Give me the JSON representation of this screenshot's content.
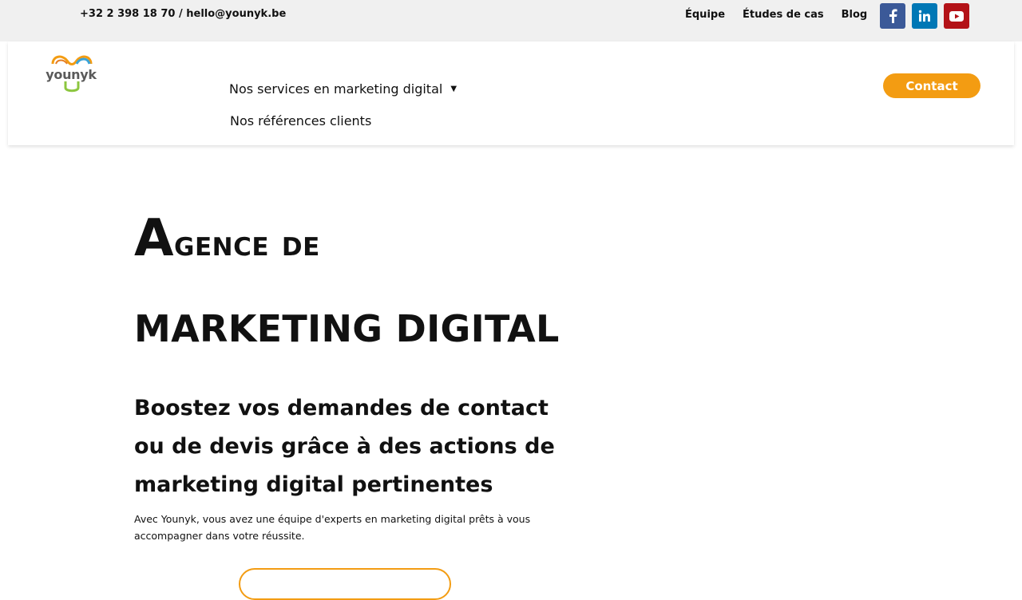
{
  "topbar": {
    "contact_line": "+32 2 398 18 70 / hello@younyk.be",
    "links": [
      "Équipe",
      "Études de cas",
      "Blog"
    ],
    "social": [
      {
        "icon": "facebook-icon",
        "color": "#3b5998"
      },
      {
        "icon": "linkedin-icon",
        "color": "#0077b5"
      },
      {
        "icon": "youtube-icon",
        "color": "#b31217"
      }
    ]
  },
  "header": {
    "logo_text": "younyk",
    "nav": {
      "services": "Nos services en marketing digital",
      "references": "Nos références clients"
    },
    "contact_button": "Contact"
  },
  "hero": {
    "title_line1_initial": "A",
    "title_line1_rest": "gence de",
    "title_line2": "MARKETING DIGITAL",
    "subtitle": "Boostez vos demandes de contact ou de devis grâce à des actions de marketing digital pertinentes",
    "text": "Avec Younyk, vous avez une équipe d'experts en marketing digital prêts à vous accompagner dans votre réussite."
  },
  "colors": {
    "accent": "#f39c12",
    "topbar_bg": "#f0f0f0"
  }
}
